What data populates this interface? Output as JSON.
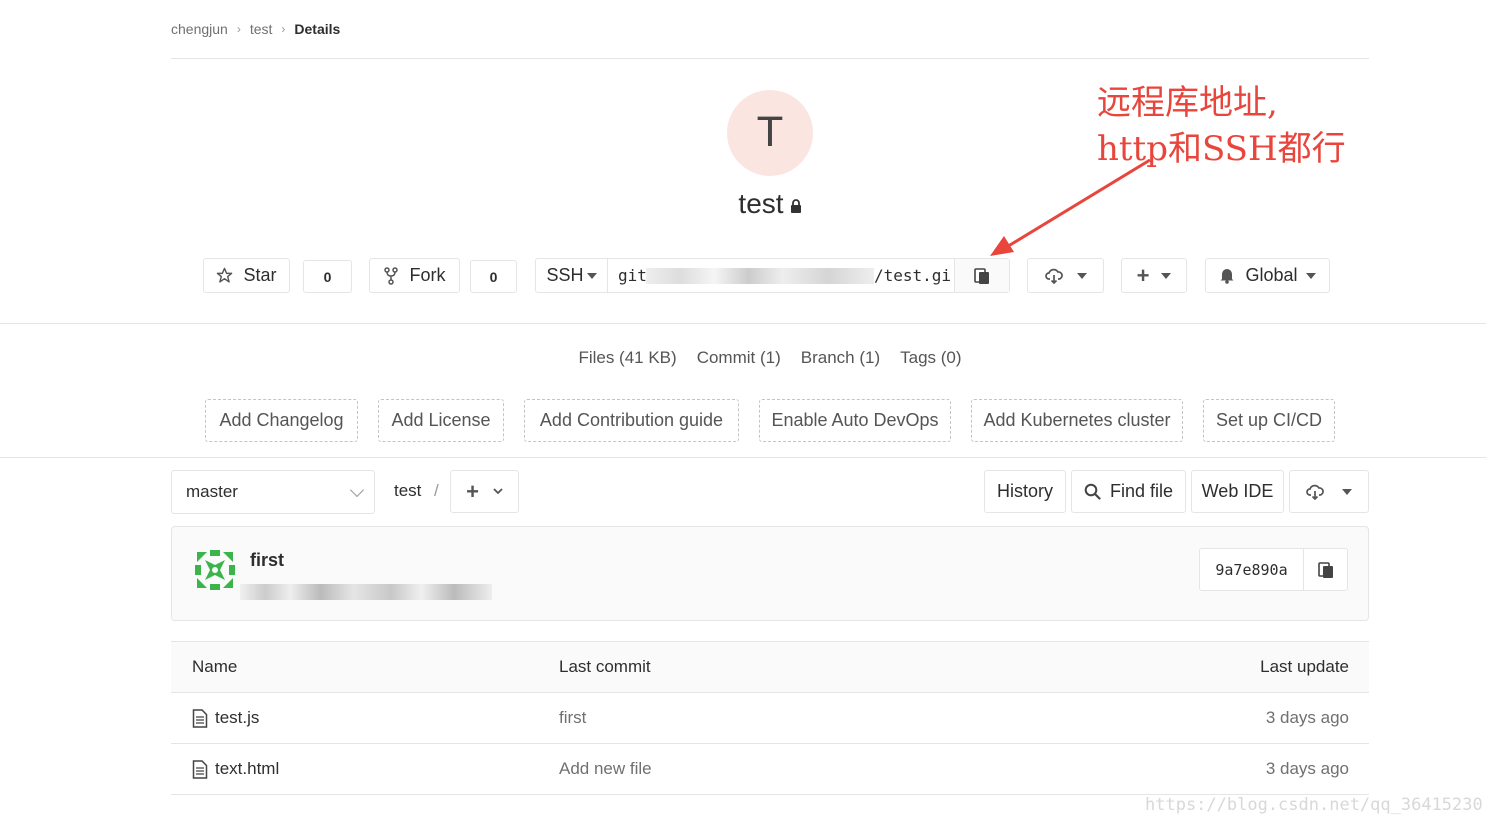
{
  "breadcrumb": {
    "items": [
      "chengjun",
      "test",
      "Details"
    ]
  },
  "project": {
    "avatar_letter": "T",
    "name": "test"
  },
  "actions": {
    "star_label": "Star",
    "star_count": "0",
    "fork_label": "Fork",
    "fork_count": "0",
    "clone_protocol": "SSH",
    "clone_url_prefix": "git",
    "clone_url_suffix": "/test.gi",
    "notify_label": "Global"
  },
  "stats": [
    "Files (41 KB)",
    "Commit (1)",
    "Branch (1)",
    "Tags (0)"
  ],
  "quick_add": [
    "Add Changelog",
    "Add License",
    "Add Contribution guide",
    "Enable Auto DevOps",
    "Add Kubernetes cluster",
    "Set up CI/CD"
  ],
  "repo_bar": {
    "branch": "master",
    "path": "test",
    "path_separator": "/",
    "history_label": "History",
    "find_file_label": "Find file",
    "web_ide_label": "Web IDE"
  },
  "last_commit": {
    "title": "first",
    "sha": "9a7e890a"
  },
  "file_table": {
    "headers": [
      "Name",
      "Last commit",
      "Last update"
    ],
    "rows": [
      {
        "name": "test.js",
        "commit": "first",
        "updated": "3 days ago"
      },
      {
        "name": "text.html",
        "commit": "Add new file",
        "updated": "3 days ago"
      }
    ]
  },
  "annotation": {
    "text": "远程库地址,\nhttp和SSH都行"
  },
  "watermark": "https://blog.csdn.net/qq_36415230",
  "colors": {
    "annotation": "#e8463c",
    "avatar_bg": "#fbe5e1",
    "border": "#e5e5e5"
  }
}
